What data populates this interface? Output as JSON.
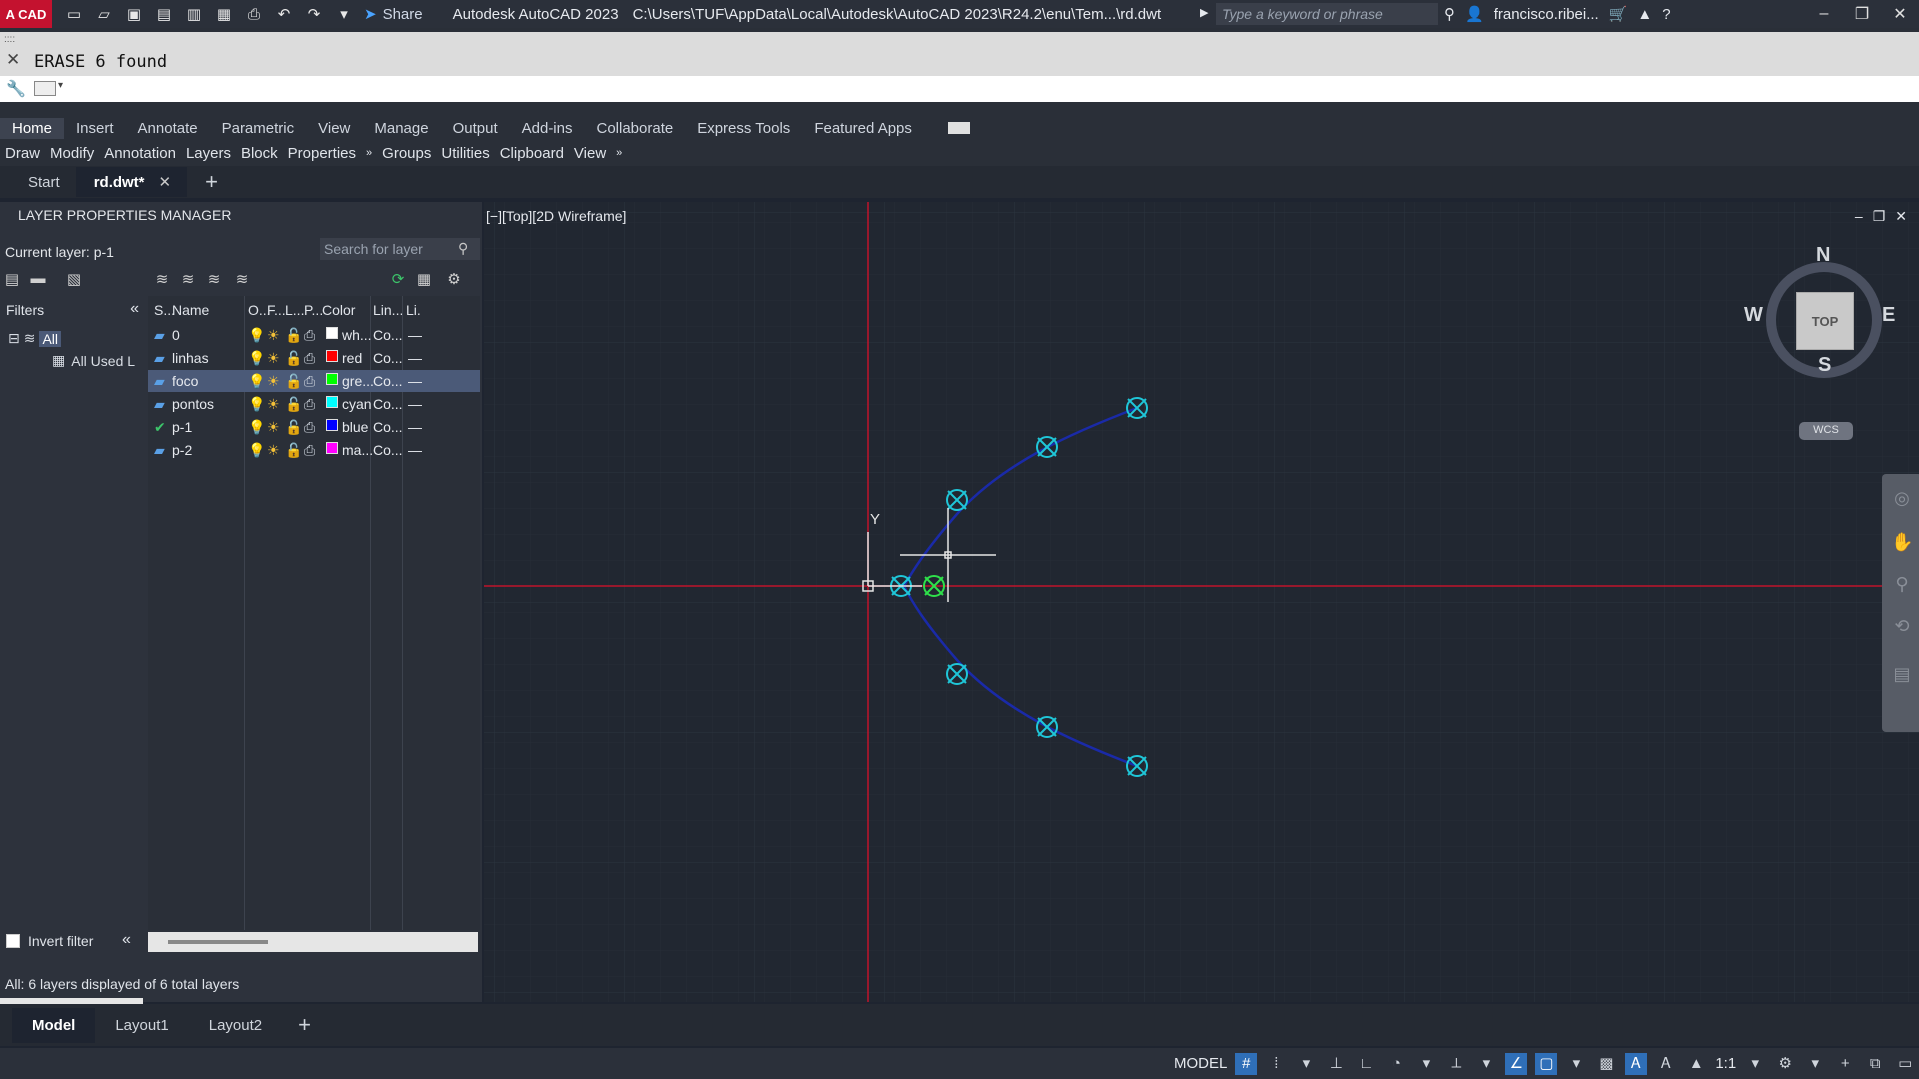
{
  "titlebar": {
    "logo_text": "A CAD",
    "share_label": "Share",
    "app_title": "Autodesk AutoCAD 2023",
    "file_path": "C:\\Users\\TUF\\AppData\\Local\\Autodesk\\AutoCAD 2023\\R24.2\\enu\\Tem...\\rd.dwt",
    "search_placeholder": "Type a keyword or phrase",
    "user_name": "francisco.ribei..."
  },
  "command": {
    "history_text": "ERASE 6 found"
  },
  "ribbon": {
    "tabs": [
      "Home",
      "Insert",
      "Annotate",
      "Parametric",
      "View",
      "Manage",
      "Output",
      "Add-ins",
      "Collaborate",
      "Express Tools",
      "Featured Apps"
    ],
    "panels": [
      "Draw",
      "Modify",
      "Annotation",
      "Layers",
      "Block",
      "Properties",
      "Groups",
      "Utilities",
      "Clipboard",
      "View"
    ]
  },
  "doctabs": {
    "start": "Start",
    "active": "rd.dwt*"
  },
  "lpm": {
    "title": "LAYER PROPERTIES MANAGER",
    "current_layer": "Current layer: p-1",
    "search_placeholder": "Search for layer",
    "filters_label": "Filters",
    "tree_all": "All",
    "tree_used": "All Used L",
    "columns": [
      "S...",
      "Name",
      "O...",
      "F...",
      "L...",
      "P...",
      "Color",
      "Lin...",
      "Li."
    ],
    "layers": [
      {
        "name": "0",
        "color_name": "wh...",
        "color": "#ffffff",
        "linetype": "Co...",
        "current": false,
        "selected": false
      },
      {
        "name": "linhas",
        "color_name": "red",
        "color": "#ff0000",
        "linetype": "Co...",
        "current": false,
        "selected": false
      },
      {
        "name": "foco",
        "color_name": "gre...",
        "color": "#00ff00",
        "linetype": "Co...",
        "current": false,
        "selected": true
      },
      {
        "name": "pontos",
        "color_name": "cyan",
        "color": "#00ffff",
        "linetype": "Co...",
        "current": false,
        "selected": false
      },
      {
        "name": "p-1",
        "color_name": "blue",
        "color": "#0000ff",
        "linetype": "Co...",
        "current": true,
        "selected": false
      },
      {
        "name": "p-2",
        "color_name": "ma...",
        "color": "#ff00ff",
        "linetype": "Co...",
        "current": false,
        "selected": false
      }
    ],
    "invert_filter": "Invert filter",
    "status": "All: 6 layers displayed of 6 total layers"
  },
  "viewport": {
    "label": "[−][Top][2D Wireframe]",
    "viewcube_top": "TOP",
    "compass": {
      "n": "N",
      "s": "S",
      "e": "E",
      "w": "W"
    },
    "wcs": "WCS",
    "ucs_y": "Y"
  },
  "layout_tabs": [
    "Model",
    "Layout1",
    "Layout2"
  ],
  "status": {
    "model": "MODEL",
    "scale": "1:1"
  },
  "colors": {
    "accent_blue": "#2f6fb8",
    "axis_red": "#c0142a",
    "curve_blue": "#1a2aa8",
    "node_cyan": "#1fc6d8",
    "focus_green": "#2ee04a"
  }
}
